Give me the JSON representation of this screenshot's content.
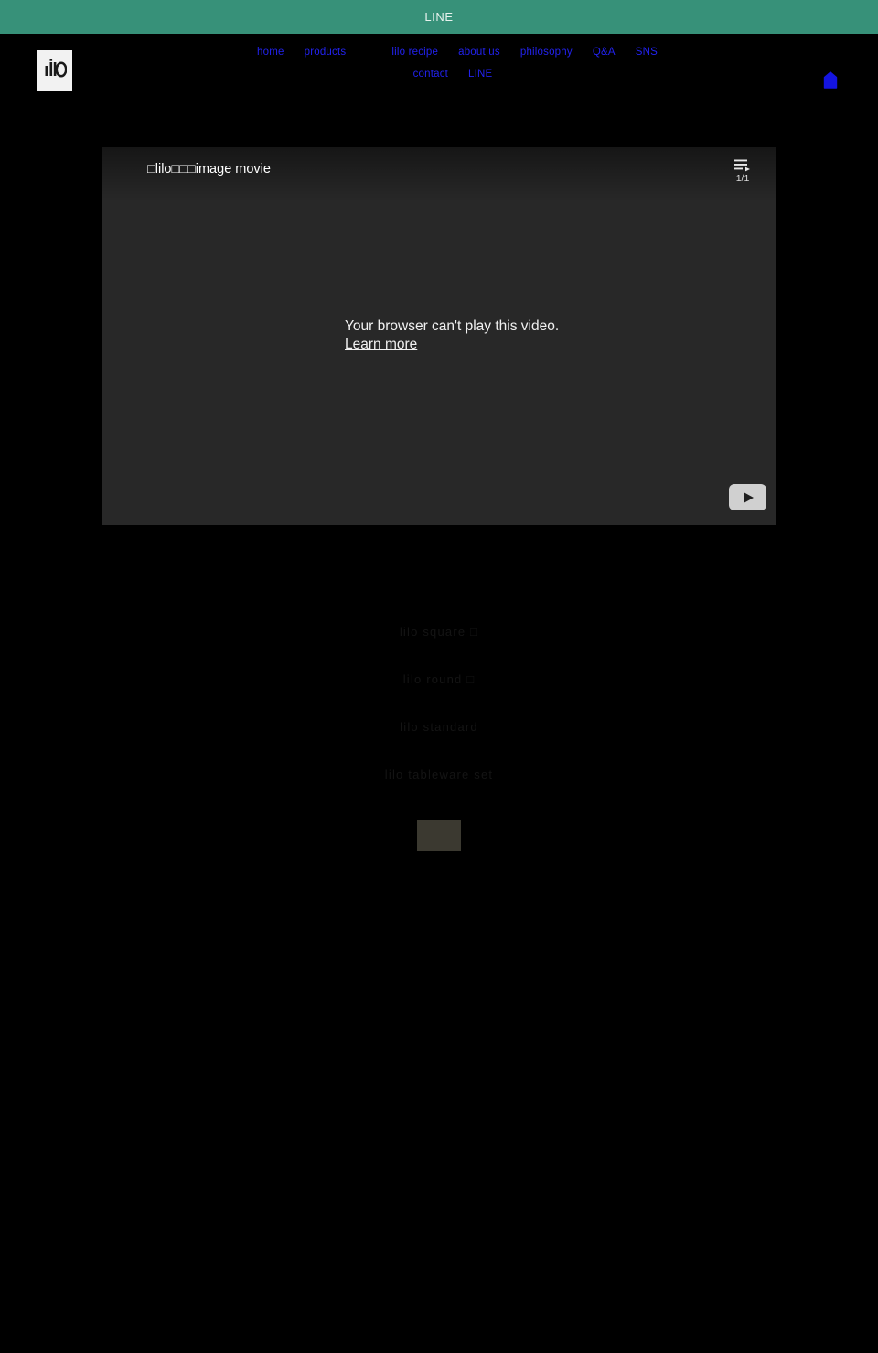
{
  "banner": {
    "label": "LINE",
    "bg_color": "#379179"
  },
  "header": {
    "logo_alt": "lilo-logo",
    "nav": {
      "row1": [
        {
          "label": "home"
        },
        {
          "label": "products"
        },
        {
          "label": "lilo recipe"
        },
        {
          "label": "about us"
        },
        {
          "label": "philosophy"
        },
        {
          "label": "Q&A"
        },
        {
          "label": "SNS"
        }
      ],
      "row2": [
        {
          "label": "contact"
        },
        {
          "label": "LINE"
        }
      ]
    },
    "cart_label": "cart",
    "link_color": "#2222ee"
  },
  "video": {
    "title": "□lilo□□□image movie",
    "playlist_count": "1/1",
    "error_line": "Your browser can't play this video.",
    "learn_more": "Learn more",
    "play_label": "Play",
    "bg_color": "#282828"
  },
  "products": [
    {
      "name": "lilo square □"
    },
    {
      "name": "lilo round □"
    },
    {
      "name": "lilo standard"
    },
    {
      "name": "lilo tableware set"
    }
  ],
  "thumbnail": {
    "label": "product-image",
    "color": "#3b3930"
  }
}
